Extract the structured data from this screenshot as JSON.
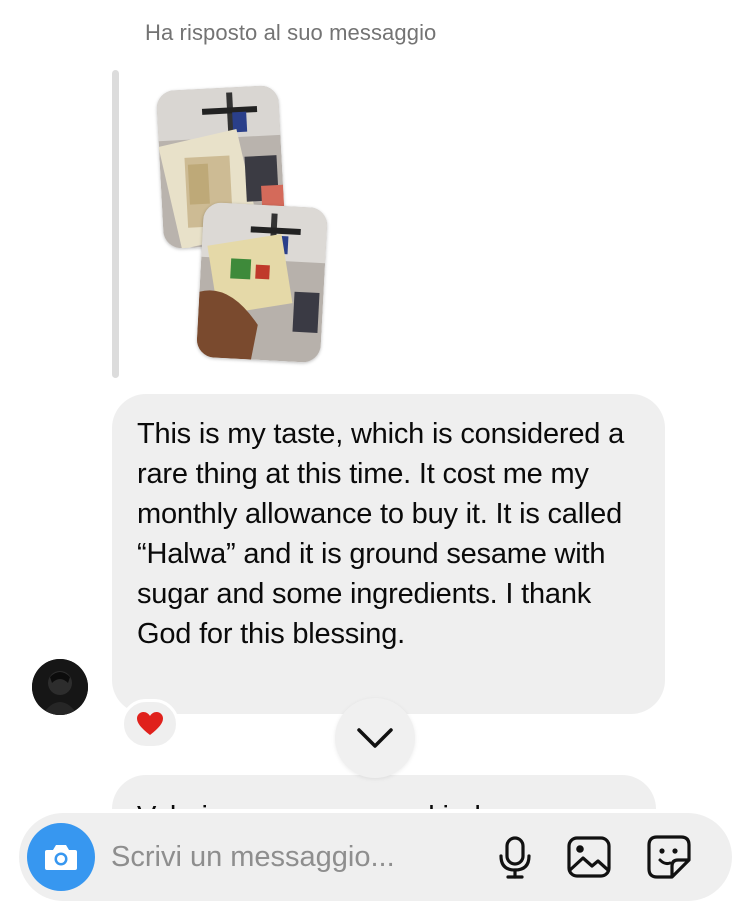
{
  "reply": {
    "caption": "Ha risposto al suo messaggio"
  },
  "message": {
    "text": "This is my taste, which is considered a rare thing at this time. It cost me my monthly allowance to buy it. It is called “Halwa” and it is ground sesame with sugar and some ingredients. I thank God for this blessing.",
    "reaction": "heart"
  },
  "next_message": {
    "text_partial": "Valeria, you are a very kind"
  },
  "composer": {
    "placeholder": "Scrivi un messaggio..."
  },
  "icons": {
    "camera": "camera-icon",
    "mic": "microphone-icon",
    "gallery": "gallery-icon",
    "sticker": "sticker-icon",
    "scroll": "chevron-down-icon"
  },
  "colors": {
    "accent": "#3797f0",
    "bubble": "#efefef",
    "reaction_heart": "#e0211c",
    "caption": "#737373"
  }
}
